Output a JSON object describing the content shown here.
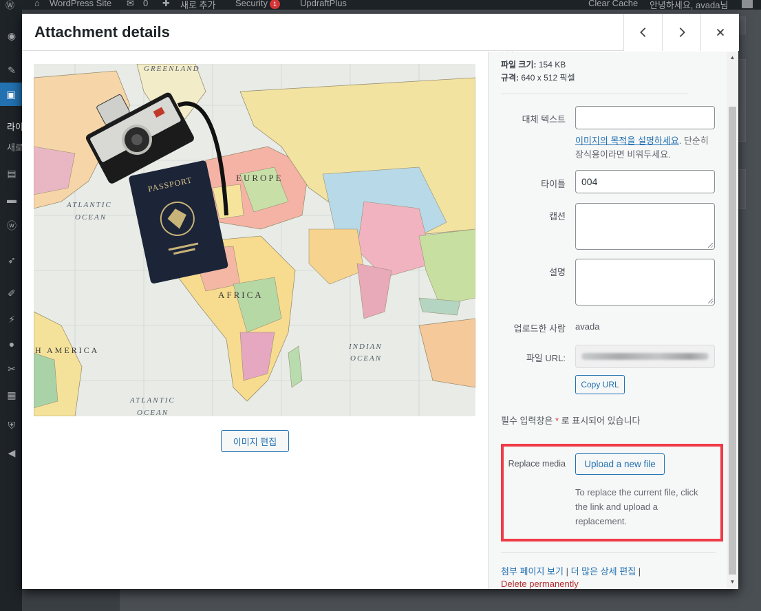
{
  "adminbar": {
    "site_name": "WordPress Site",
    "comments_count": "0",
    "new_label": "새로 추가",
    "security_label": "Security",
    "security_badge": "1",
    "updraft_label": "UpdraftPlus",
    "clear_cache_label": "Clear Cache",
    "greeting": "안녕하세요, avada님"
  },
  "sidemenu": {
    "sub_items": [
      "라이",
      "새로"
    ]
  },
  "modal": {
    "title": "Attachment details",
    "edit_image_label": "이미지 편집"
  },
  "image_labels": {
    "greenland": "GREENLAND",
    "atlantic_ocean_top": [
      "ATLANTIC",
      "OCEAN"
    ],
    "atlantic_ocean_bottom": [
      "ATLANTIC",
      "OCEAN"
    ],
    "europe": "EUROPE",
    "africa": "AFRICA",
    "indian_ocean": [
      "INDIAN",
      "OCEAN"
    ],
    "south_america": "H AMERICA",
    "passport": "PASSPORT"
  },
  "details": {
    "file_size_label": "파일 크기:",
    "file_size_value": "154 KB",
    "dimensions_label": "규격:",
    "dimensions_value": "640 x 512 픽셀"
  },
  "fields": {
    "alt_text": {
      "label": "대체 텍스트",
      "value": ""
    },
    "alt_help_link": "이미지의 목적을 설명하세요",
    "alt_help_text": ". 단순히 장식용이라면 비워두세요.",
    "title": {
      "label": "타이틀",
      "value": "004"
    },
    "caption": {
      "label": "캡션",
      "value": ""
    },
    "description": {
      "label": "설명",
      "value": ""
    },
    "uploaded_by": {
      "label": "업로드한 사람",
      "value": "avada"
    },
    "file_url": {
      "label": "파일 URL:"
    },
    "copy_url_label": "Copy URL"
  },
  "required_note": {
    "before": "필수 입력창은 ",
    "star": "*",
    "after": " 로 표시되어 있습니다"
  },
  "replace_media": {
    "label": "Replace media",
    "button": "Upload a new file",
    "help": "To replace the current file, click the link and upload a replacement."
  },
  "footer_links": {
    "view_attachment": "첨부 페이지 보기",
    "more_details": "더 많은 상세 편집",
    "separator": "|",
    "delete": "Delete permanently"
  },
  "colors": {
    "accent": "#2271b1",
    "highlight_box": "#ef3b46",
    "delete": "#b32d2e"
  }
}
